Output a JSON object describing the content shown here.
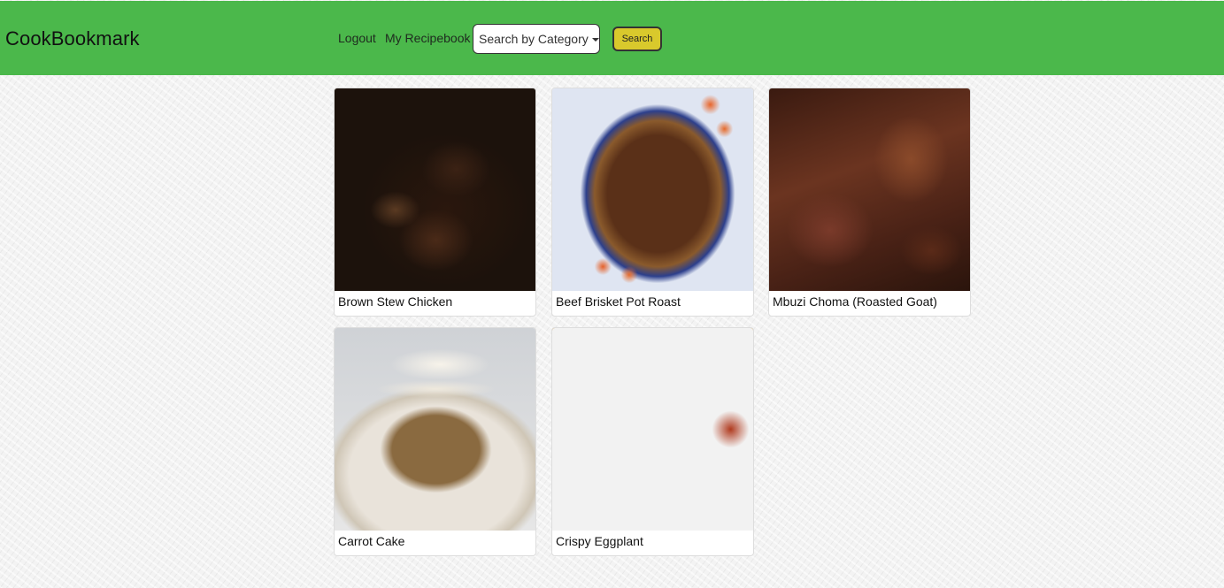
{
  "navbar": {
    "brand": "CookBookmark",
    "logout_label": "Logout",
    "recipebook_label": "My Recipebook",
    "category_select_label": "Search by Category",
    "search_button_label": "Search"
  },
  "recipes": [
    {
      "title": "Brown Stew Chicken",
      "image": "brown-stew-chicken-photo"
    },
    {
      "title": "Beef Brisket Pot Roast",
      "image": "beef-brisket-pot-roast-photo"
    },
    {
      "title": "Mbuzi Choma (Roasted Goat)",
      "image": "mbuzi-choma-photo"
    },
    {
      "title": "Carrot Cake",
      "image": "carrot-cake-photo"
    },
    {
      "title": "Crispy Eggplant",
      "image": "crispy-eggplant-photo"
    }
  ],
  "colors": {
    "navbar": "#4bb84b",
    "search_button": "#d9c92c"
  }
}
